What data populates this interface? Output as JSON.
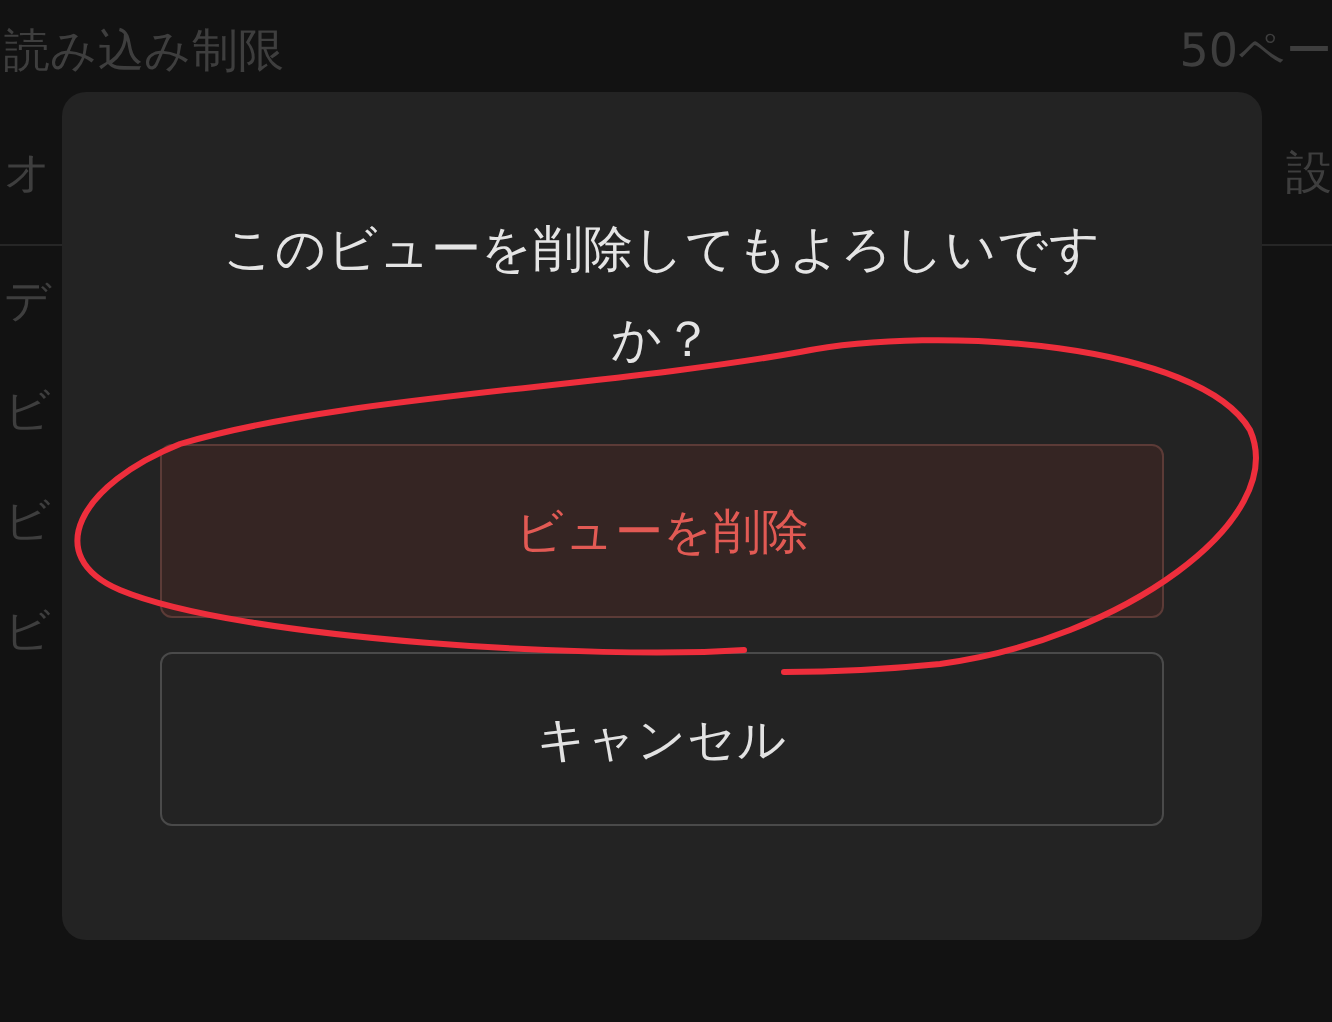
{
  "settings": {
    "rows": [
      {
        "label": "読み込み制限",
        "value": "50ペー"
      },
      {
        "label": "オ",
        "value": "設"
      }
    ]
  },
  "views": {
    "items": [
      {
        "label": "デ"
      },
      {
        "label": "ビ"
      },
      {
        "label": "ビ"
      },
      {
        "label": "ビ"
      }
    ]
  },
  "dialog": {
    "message": "このビューを削除してもよろしいですか？",
    "buttons": [
      {
        "label": "ビューを削除",
        "kind": "destructive"
      },
      {
        "label": "キャンセル",
        "kind": "cancel"
      }
    ]
  }
}
